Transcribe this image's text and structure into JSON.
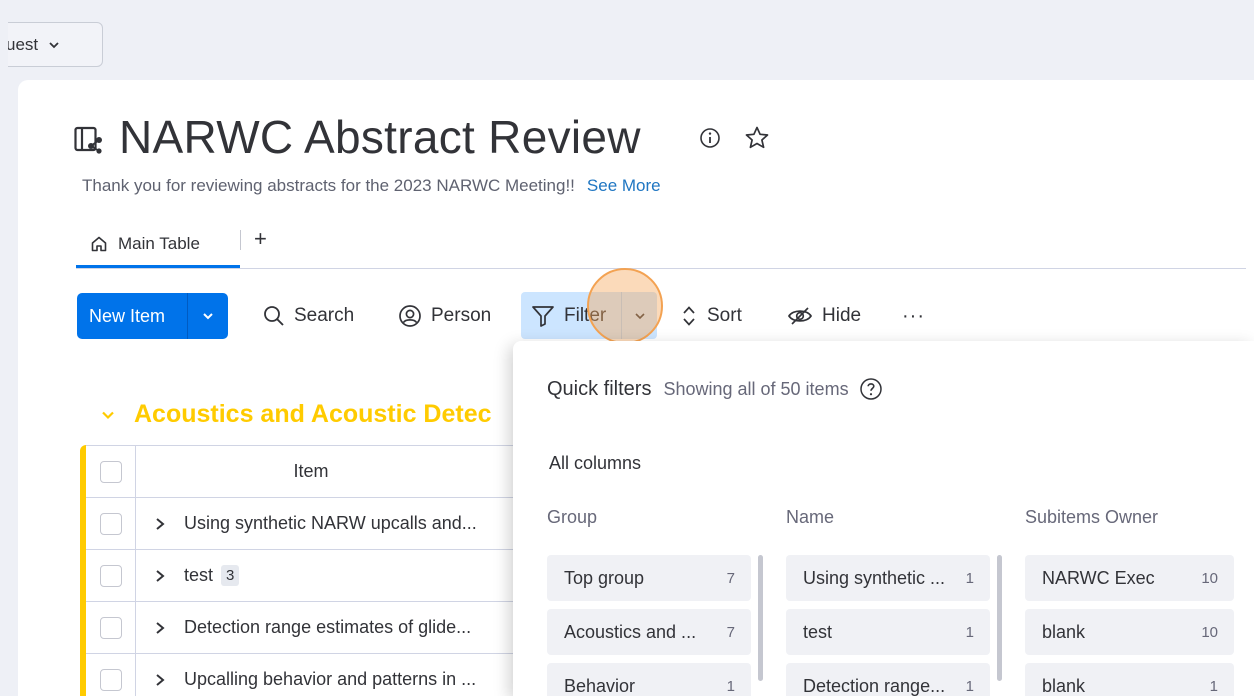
{
  "topbar": {
    "guest_label": "uest"
  },
  "board": {
    "title": "NARWC Abstract Review",
    "description": "Thank you for reviewing abstracts for the 2023 NARWC Meeting!!",
    "see_more": "See More"
  },
  "tabs": {
    "main_label": "Main Table",
    "add_label": "+"
  },
  "toolbar": {
    "new_item": "New Item",
    "search": "Search",
    "person": "Person",
    "filter": "Filter",
    "sort": "Sort",
    "hide": "Hide",
    "more": "···"
  },
  "group": {
    "title": "Acoustics and Acoustic Detec",
    "color": "#ffcb00",
    "column_header": "Item",
    "rows": [
      {
        "text": "Using synthetic NARW upcalls and..."
      },
      {
        "text": "test",
        "badge": "3"
      },
      {
        "text": "Detection range estimates of glide..."
      },
      {
        "text": "Upcalling behavior and patterns in ..."
      }
    ]
  },
  "quick_filters": {
    "title": "Quick filters",
    "subtitle": "Showing all of 50 items",
    "all_columns": "All columns",
    "columns": [
      {
        "header": "Group",
        "items": [
          {
            "label": "Top group",
            "count": "7"
          },
          {
            "label": "Acoustics and ...",
            "count": "7"
          },
          {
            "label": "Behavior",
            "count": "1"
          }
        ]
      },
      {
        "header": "Name",
        "items": [
          {
            "label": "Using synthetic ...",
            "count": "1"
          },
          {
            "label": "test",
            "count": "1"
          },
          {
            "label": "Detection range...",
            "count": "1"
          }
        ]
      },
      {
        "header": "Subitems Owner",
        "items": [
          {
            "label": "NARWC Exec",
            "count": "10"
          },
          {
            "label": "blank",
            "count": "10"
          },
          {
            "label": "blank",
            "count": "1"
          }
        ]
      }
    ]
  },
  "colors": {
    "accent": "#0073ea",
    "filter_active": "#cce5ff",
    "group": "#ffcb00",
    "link": "#1f76c2"
  }
}
